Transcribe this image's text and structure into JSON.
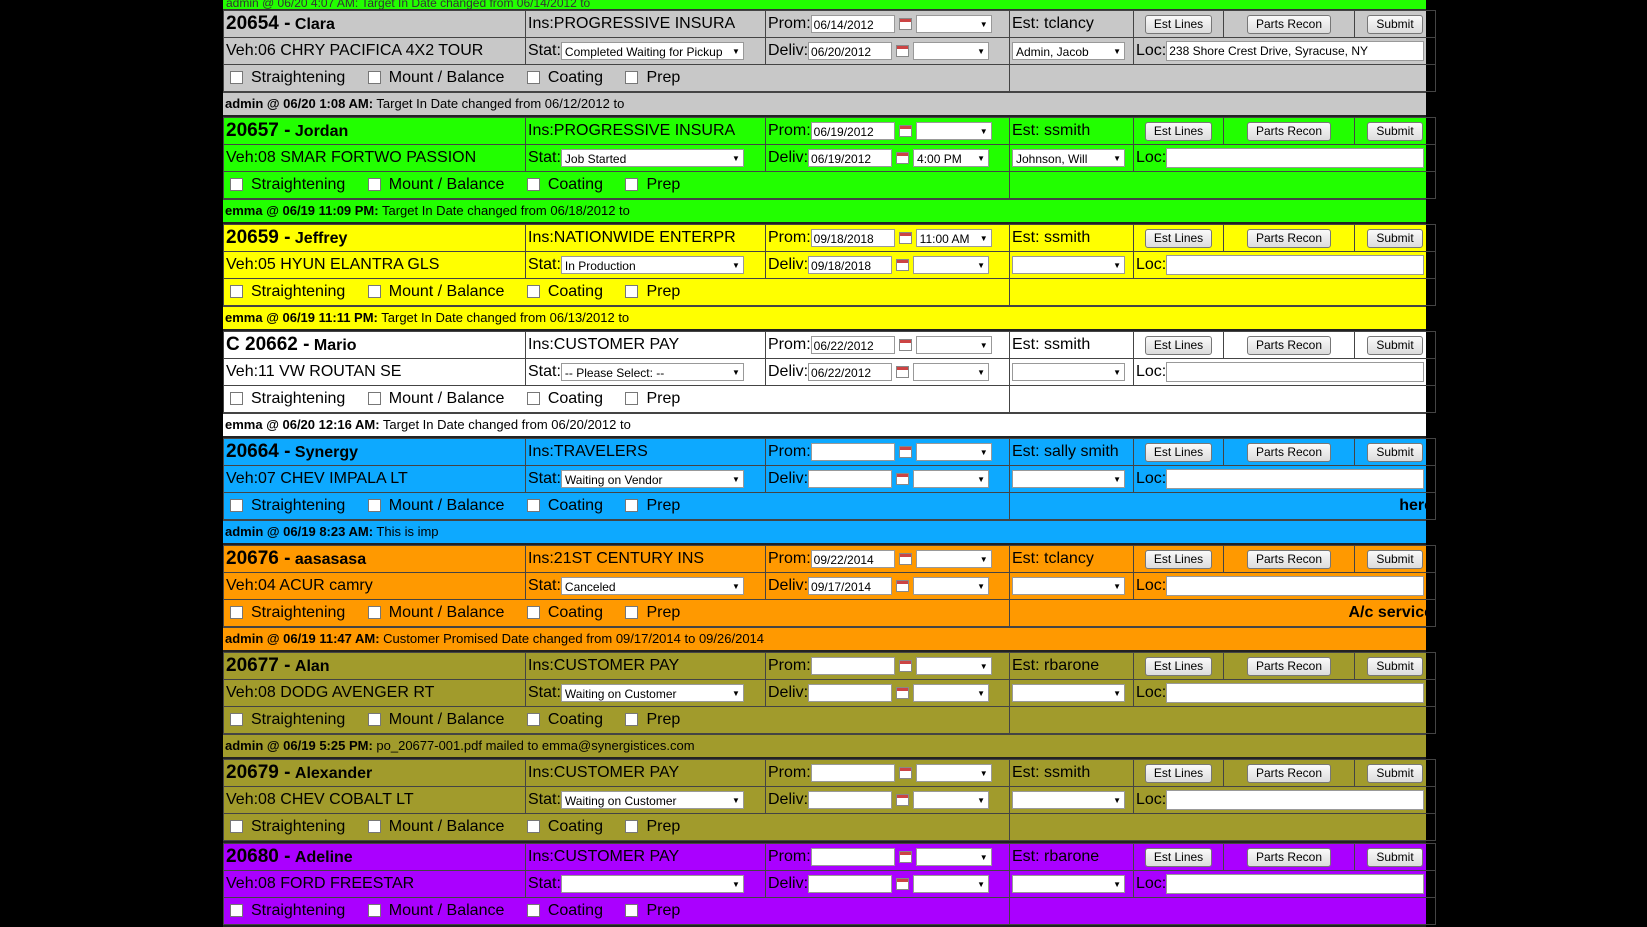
{
  "top_note": "admin @ 06/20 4:07 AM: Target In Date changed from 06/14/2012 to",
  "labels": {
    "ins": "Ins:",
    "veh": "Veh:",
    "stat": "Stat:",
    "prom": "Prom:",
    "deliv": "Deliv:",
    "est": "Est:",
    "loc": "Loc:",
    "est_lines": "Est Lines",
    "parts_recon": "Parts Recon",
    "submit": "Submit",
    "ops": [
      "Straightening",
      "Mount / Balance",
      "Coating",
      "Prep"
    ]
  },
  "jobs": [
    {
      "color": "#c8c8c8",
      "number": "20654 -",
      "name": "Clara",
      "ins": "PROGRESSIVE INSURA",
      "veh": "06 CHRY PACIFICA 4X2 TOUR",
      "stat": "Completed Waiting for Pickup",
      "prom_date": "06/14/2012",
      "prom_time": "",
      "deliv_date": "06/20/2012",
      "deliv_time": "",
      "est": "tclancy",
      "tech": "Admin, Jacob",
      "loc": "238 Shore Crest Drive, Syracuse, NY",
      "comment": "",
      "note_author": "admin @ 06/20 1:08 AM:",
      "note_text": " Target In Date changed from 06/12/2012 to"
    },
    {
      "color": "#22ff00",
      "number": "20657 -",
      "name": "Jordan",
      "ins": "PROGRESSIVE INSURA",
      "veh": "08 SMAR FORTWO PASSION",
      "stat": "Job Started",
      "prom_date": "06/19/2012",
      "prom_time": "",
      "deliv_date": "06/19/2012",
      "deliv_time": "4:00 PM",
      "est": "ssmith",
      "tech": "Johnson, Will",
      "loc": "",
      "comment": "",
      "note_author": "emma @ 06/19 11:09 PM:",
      "note_text": " Target In Date changed from 06/18/2012 to"
    },
    {
      "color": "#ffff00",
      "number": "20659 -",
      "name": "Jeffrey",
      "ins": "NATIONWIDE ENTERPR",
      "veh": "05 HYUN ELANTRA GLS",
      "stat": "In Production",
      "prom_date": "09/18/2018",
      "prom_time": "11:00 AM",
      "deliv_date": "09/18/2018",
      "deliv_time": "",
      "est": "ssmith",
      "tech": "",
      "loc": "",
      "comment": "",
      "note_author": "emma @ 06/19 11:11 PM:",
      "note_text": " Target In Date changed from 06/13/2012 to"
    },
    {
      "color": "#ffffff",
      "number": "C 20662 -",
      "name": "Mario",
      "ins": "CUSTOMER PAY",
      "veh": "11 VW ROUTAN SE",
      "stat": "-- Please Select: --",
      "prom_date": "06/22/2012",
      "prom_time": "",
      "deliv_date": "06/22/2012",
      "deliv_time": "",
      "est": "ssmith",
      "tech": "",
      "loc": "",
      "comment": "",
      "note_author": "emma @ 06/20 12:16 AM:",
      "note_text": " Target In Date changed from 06/20/2012 to"
    },
    {
      "color": "#0da9ff",
      "number": "20664 -",
      "name": "Synergy",
      "ins": "TRAVELERS",
      "veh": "07 CHEV IMPALA LT",
      "stat": "Waiting on Vendor",
      "prom_date": "",
      "prom_time": "",
      "deliv_date": "",
      "deliv_time": "",
      "est": "sally smith",
      "tech": "",
      "loc": "",
      "comment": "here",
      "note_author": "admin @ 06/19 8:23 AM:",
      "note_text": " This is imp"
    },
    {
      "color": "#ff9900",
      "number": "20676 -",
      "name": "aasasasa",
      "ins": "21ST CENTURY INS",
      "veh": "04 ACUR camry",
      "stat": "Canceled",
      "prom_date": "09/22/2014",
      "prom_time": "",
      "deliv_date": "09/17/2014",
      "deliv_time": "",
      "est": "tclancy",
      "tech": "",
      "loc": "",
      "comment": "A/c service",
      "note_author": "admin @ 06/19 11:47 AM:",
      "note_text": " Customer Promised Date changed from 09/17/2014 to 09/26/2014"
    },
    {
      "color": "#a19b2c",
      "number": "20677 -",
      "name": "Alan",
      "ins": "CUSTOMER PAY",
      "veh": "08 DODG AVENGER RT",
      "stat": "Waiting on Customer",
      "prom_date": "",
      "prom_time": "",
      "deliv_date": "",
      "deliv_time": "",
      "est": "rbarone",
      "tech": "",
      "loc": "",
      "comment": "",
      "note_author": "admin @ 06/19 5:25 PM:",
      "note_text": " po_20677-001.pdf mailed to emma@synergistices.com"
    },
    {
      "color": "#a19b2c",
      "number": "20679 -",
      "name": "Alexander",
      "ins": "CUSTOMER PAY",
      "veh": "08 CHEV COBALT LT",
      "stat": "Waiting on Customer",
      "prom_date": "",
      "prom_time": "",
      "deliv_date": "",
      "deliv_time": "",
      "est": "ssmith",
      "tech": "",
      "loc": "",
      "comment": "",
      "note_author": "",
      "note_text": ""
    },
    {
      "color": "#aa00ff",
      "number": "20680 -",
      "name": "Adeline",
      "ins": "CUSTOMER PAY",
      "veh": "08 FORD FREESTAR",
      "stat": "",
      "prom_date": "",
      "prom_time": "",
      "deliv_date": "",
      "deliv_time": "",
      "est": "rbarone",
      "tech": "",
      "loc": "",
      "comment": "",
      "note_author": "",
      "note_text": ""
    }
  ]
}
